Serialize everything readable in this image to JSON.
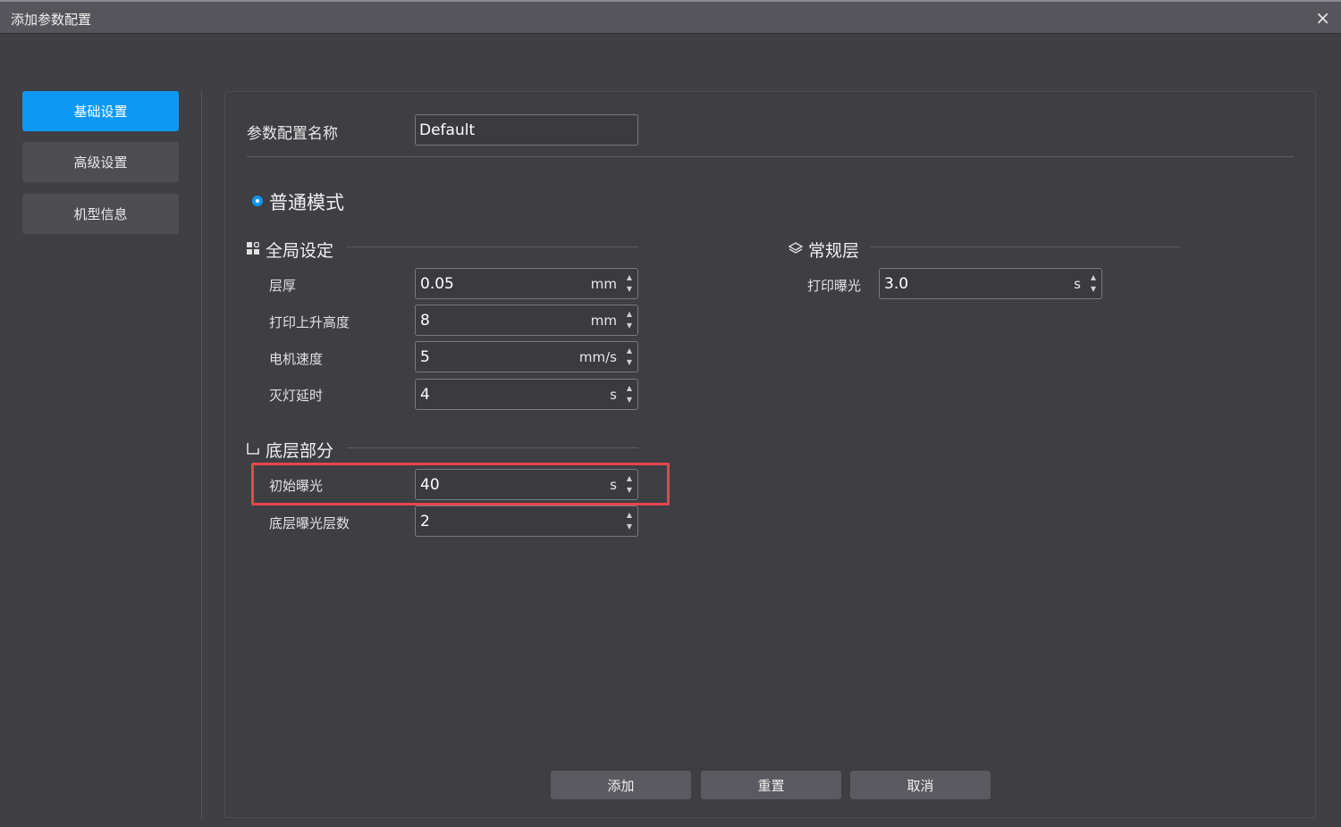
{
  "window": {
    "title": "添加参数配置",
    "close_symbol": "×"
  },
  "nav": {
    "items": [
      {
        "label": "基础设置",
        "active": true
      },
      {
        "label": "高级设置",
        "active": false
      },
      {
        "label": "机型信息",
        "active": false
      }
    ]
  },
  "profile": {
    "name_label": "参数配置名称",
    "name_value": "Default"
  },
  "mode": {
    "label": "普通模式",
    "selected": true
  },
  "global": {
    "title": "全局设定",
    "fields": [
      {
        "label": "层厚",
        "value": "0.05",
        "unit": "mm"
      },
      {
        "label": "打印上升高度",
        "value": "8",
        "unit": "mm"
      },
      {
        "label": "电机速度",
        "value": "5",
        "unit": "mm/s"
      },
      {
        "label": "灭灯延时",
        "value": "4",
        "unit": "s"
      }
    ]
  },
  "bottom": {
    "title": "底层部分",
    "fields": [
      {
        "label": "初始曝光",
        "value": "40",
        "unit": "s"
      },
      {
        "label": "底层曝光层数",
        "value": "2",
        "unit": ""
      }
    ]
  },
  "normal": {
    "title": "常规层",
    "fields": [
      {
        "label": "打印曝光",
        "value": "3.0",
        "unit": "s"
      }
    ]
  },
  "footer": {
    "add_label": "添加",
    "reset_label": "重置",
    "cancel_label": "取消"
  },
  "colors": {
    "accent": "#0e98f5",
    "highlight": "#e8454f",
    "background": "#3f3f44"
  }
}
